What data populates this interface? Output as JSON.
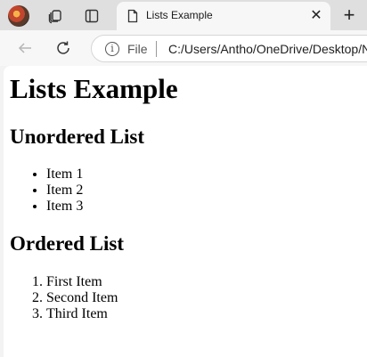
{
  "browser": {
    "tab": {
      "title": "Lists Example"
    },
    "address": {
      "scheme": "File",
      "url": "C:/Users/Antho/OneDrive/Desktop/N"
    },
    "icons": [
      "profile-avatar",
      "collections-icon",
      "tab-actions-icon",
      "doc-icon",
      "close-icon",
      "plus-icon",
      "back-icon",
      "refresh-icon",
      "info-icon"
    ]
  },
  "page": {
    "title": "Lists Example",
    "unordered": {
      "heading": "Unordered List",
      "items": [
        "Item 1",
        "Item 2",
        "Item 3"
      ]
    },
    "ordered": {
      "heading": "Ordered List",
      "items": [
        "First Item",
        "Second Item",
        "Third Item"
      ]
    }
  }
}
